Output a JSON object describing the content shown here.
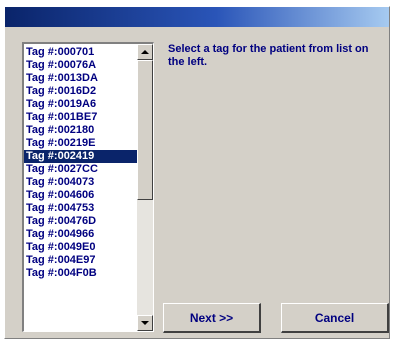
{
  "instruction": "Select a tag for the patient from list on the left.",
  "tags": [
    "Tag #:000701",
    "Tag #:00076A",
    "Tag #:0013DA",
    "Tag #:0016D2",
    "Tag #:0019A6",
    "Tag #:001BE7",
    "Tag #:002180",
    "Tag #:00219E",
    "Tag #:002419",
    "Tag #:0027CC",
    "Tag #:004073",
    "Tag #:004606",
    "Tag #:004753",
    "Tag #:00476D",
    "Tag #:004966",
    "Tag #:0049E0",
    "Tag #:004E97",
    "Tag #:004F0B"
  ],
  "selected_tag": "Tag #:002419",
  "buttons": {
    "next": "Next >>",
    "cancel": "Cancel"
  },
  "colors": {
    "title_bar": "#0a246a",
    "selection": "#0a246a",
    "text": "#000080",
    "dialog_face": "#d4d0c8"
  },
  "icons": {
    "scroll_up": "arrow-up-icon",
    "scroll_down": "arrow-down-icon"
  }
}
